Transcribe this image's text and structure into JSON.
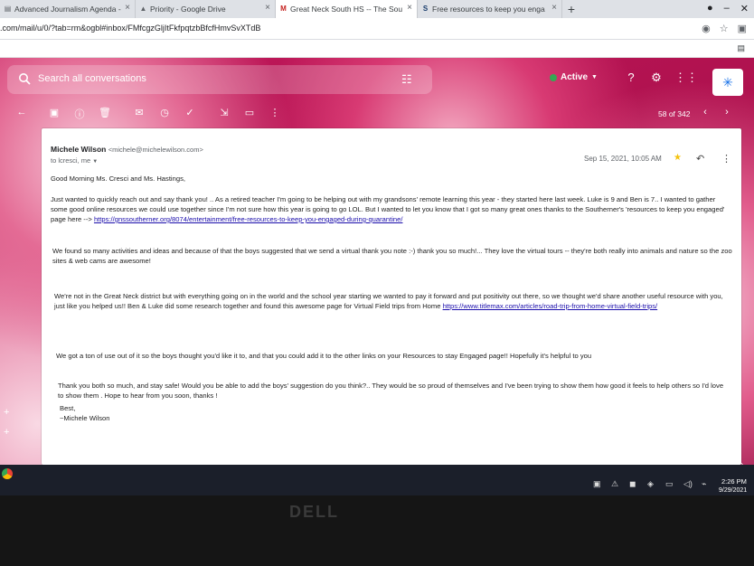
{
  "browser": {
    "tabs": [
      {
        "label": "Advanced Journalism Agenda -  ",
        "icon": "doc-icon"
      },
      {
        "label": "Priority - Google Drive",
        "icon": "drive-icon"
      },
      {
        "label": "Great Neck South HS -- The Sou",
        "icon": "gmail-icon"
      },
      {
        "label": "Free resources to keep you enga",
        "icon": "site-icon"
      }
    ],
    "url": ".com/mail/u/0/?tab=rm&ogbl#inbox/FMfcgzGljItFkfpqtzbBfcfHmvSvXTdB"
  },
  "gmail": {
    "search_placeholder": "Search all conversations",
    "status": "Active",
    "pager": "58 of 342"
  },
  "message": {
    "sender_name": "Michele Wilson",
    "sender_email": "<michele@michelewilson.com>",
    "to_line": "to lcresci, me",
    "date": "Sep 15, 2021, 10:05 AM",
    "greeting": "Good Morning Ms. Cresci and Ms. Hastings,",
    "p1": "Just wanted to quickly reach out and say thank you! .. As a retired teacher I'm going to be helping out with my grandsons' remote learning this year - they started here last week. Luke is 9 and Ben is 7.. I wanted to gather some good online resources we could use together since I'm not sure how this year is going to go LOL. But I wanted to let you know that I got so many great ones thanks to the Southerner's 'resources to keep you engaged' page here -->",
    "p1_link": "https://gnssoutherner.org/8074/entertainment/free-resources-to-keep-you-engaged-during-quarantine/",
    "p2": "We found so many activities and ideas and because of that the boys suggested that we send a virtual thank you note :-) thank you so much!... They love the virtual tours -- they're both really into animals and nature so the zoo sites & web cams are awesome!",
    "p3": "We're not in the Great Neck district but with everything going on in the world and the school year starting we wanted to pay it forward and put positivity out there, so we thought we'd share another useful resource with you, just like you helped us!! Ben & Luke did some research together and found this awesome page for Virtual Field trips from Home",
    "p3_link": "https://www.titlemax.com/articles/road-trip-from-home-virtual-field-trips/",
    "p4": "We got a ton of use out of it so the boys thought you'd like it to, and that you could add it to the other links on your Resources to stay Engaged page!! Hopefully it's helpful to you",
    "p5": "Thank you both so much, and stay safe! Would you be able to add the boys' suggestion do you think?.. They would be so proud of themselves and I've been trying to show them how good it feels to help others so I'd love to show them . Hope to hear from you soon, thanks !",
    "closing": "Best,",
    "signature": "~Michele Wilson"
  },
  "taskbar": {
    "time": "2:26 PM",
    "date": "9/29/2021"
  },
  "bezel": {
    "logo": "DELL"
  },
  "colors": {
    "theme": "#b9114e",
    "link": "#1a0dab",
    "star": "#f4c20d"
  }
}
